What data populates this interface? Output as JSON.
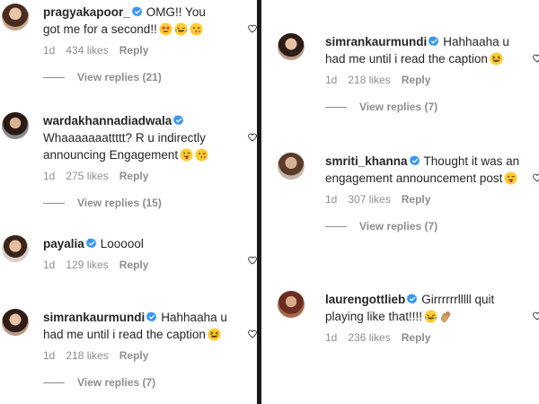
{
  "left_column": [
    {
      "username": "pragyakapoor_",
      "text": "OMG!! You got me for a second!!",
      "emojis": [
        "heart-eyes-emoji",
        "laughing-tears-emoji",
        "winking-kiss-emoji"
      ],
      "time": "1d",
      "likes": "434 likes",
      "reply": "Reply",
      "view_replies": "View replies (21)"
    },
    {
      "username": "wardakhannadiadwala",
      "text": "Whaaaaaaattttt? R u indirectly announcing Engagement",
      "emojis": [
        "tongue-wink-emoji",
        "winking-kiss-emoji"
      ],
      "time": "1d",
      "likes": "275 likes",
      "reply": "Reply",
      "view_replies": "View replies (15)"
    },
    {
      "username": "payalia",
      "text": "Loooool",
      "emojis": [],
      "time": "1d",
      "likes": "129 likes",
      "reply": "Reply",
      "view_replies": null
    },
    {
      "username": "simrankaurmundi",
      "text": "Hahhaaha u had me until i read the caption",
      "emojis": [
        "squinting-laugh-emoji"
      ],
      "time": "1d",
      "likes": "218 likes",
      "reply": "Reply",
      "view_replies": "View replies (7)"
    }
  ],
  "right_column": [
    {
      "username": "simrankaurmundi",
      "text": "Hahhaaha u had me until i read the caption",
      "emojis": [
        "squinting-laugh-emoji"
      ],
      "time": "1d",
      "likes": "218 likes",
      "reply": "Reply",
      "view_replies": "View replies (7)"
    },
    {
      "username": "smriti_khanna",
      "text": "Thought it was an engagement announcement post",
      "emojis": [
        "tongue-wink-emoji"
      ],
      "time": "1d",
      "likes": "307 likes",
      "reply": "Reply",
      "view_replies": "View replies (7)"
    },
    {
      "username": "laurengottlieb",
      "text": "Girrrrrrlllll quit playing like that!!!!",
      "emojis": [
        "laughing-tears-emoji",
        "clapping-hands-emoji"
      ],
      "time": "1d",
      "likes": "236 likes",
      "reply": "Reply",
      "view_replies": null
    }
  ],
  "colors": {
    "text": "#262626",
    "muted": "#8e8e8e",
    "verified": "#3897f0",
    "divider": "#1a1a1a"
  }
}
